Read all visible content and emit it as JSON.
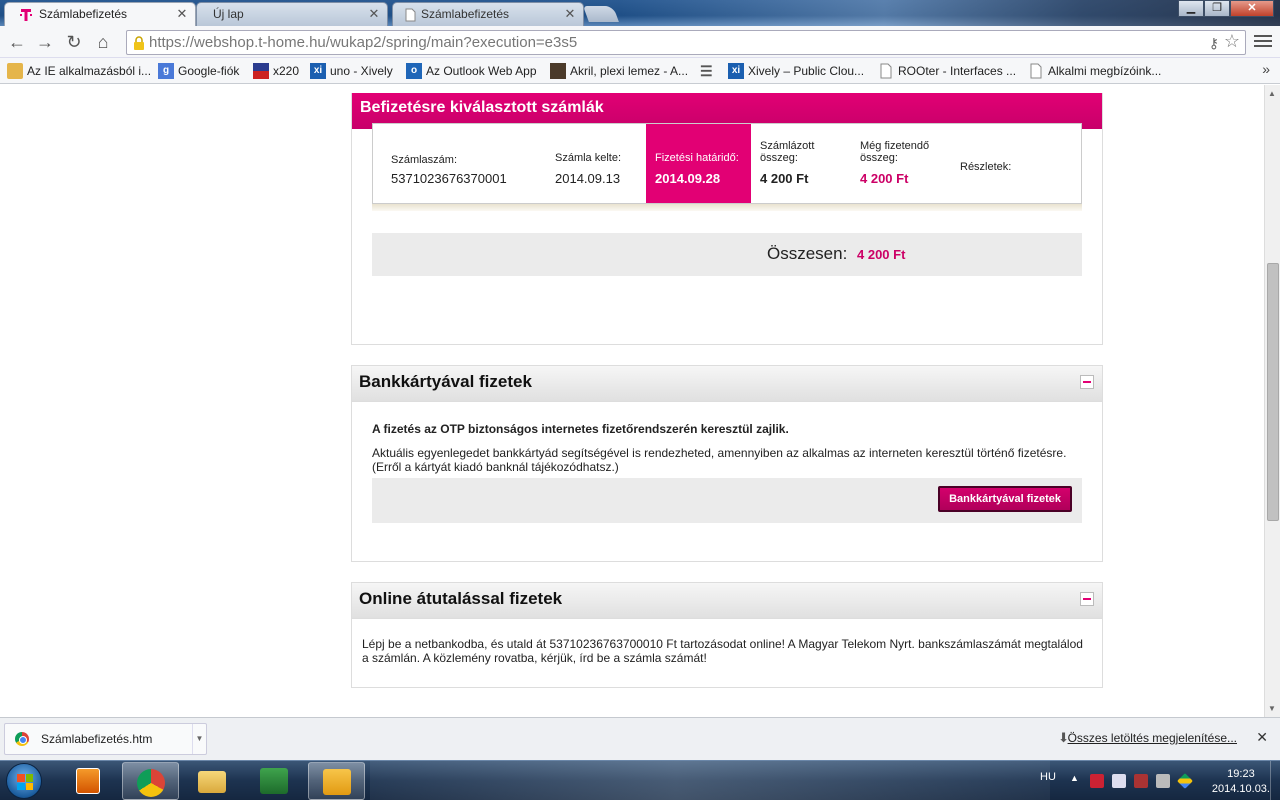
{
  "browser": {
    "tabs": [
      {
        "label": "Számlabefizetés",
        "active": true
      },
      {
        "label": "Új lap",
        "active": false
      },
      {
        "label": "Számlabefizetés",
        "active": false
      }
    ],
    "url_host": "https://webshop.t-home.hu",
    "url_path": "/wukap2/spring/main?execution=e3s5",
    "bookmarks": [
      "Az IE alkalmazásból i...",
      "Google-fiók",
      "x220",
      "uno - Xively",
      "Az Outlook Web App",
      "Akril, plexi lemez - A...",
      "Xively – Public Clou...",
      "ROOter - Interfaces ...",
      "Alkalmi megbízóink..."
    ],
    "bookmarks_more": "»"
  },
  "invoices": {
    "header": "Befizetésre kiválasztott számlák",
    "columns": {
      "number_label": "Számlaszám:",
      "number_value": "5371023676370001",
      "date_label": "Számla kelte:",
      "date_value": "2014.09.13",
      "due_label": "Fizetési határidő:",
      "due_value": "2014.09.28",
      "billed_label": "Számlázott összeg:",
      "billed_value": "4 200 Ft",
      "remaining_label": "Még fizetendő összeg:",
      "remaining_value": "4 200 Ft",
      "details_label": "Részletek:"
    },
    "total_label": "Összesen:",
    "total_value": "4 200 Ft"
  },
  "card_payment": {
    "header": "Bankkártyával fizetek",
    "intro": "A fizetés az OTP biztonságos internetes fizetőrendszerén keresztül zajlik.",
    "info": "Aktuális egyenlegedet bankkártyád segítségével is rendezheted, amennyiben az alkalmas az interneten keresztül történő fizetésre. (Erről a kártyát kiadó banknál tájékozódhatsz.)",
    "button": "Bankkártyával fizetek"
  },
  "transfer_payment": {
    "header": "Online átutalással fizetek",
    "text": "Lépj be a netbankodba, és utald át 53710236763700010 Ft tartozásodat online! A Magyar Telekom Nyrt. bankszámlaszámát megtalálod a számlán. A közlemény rovatba, kérjük, írd be a számla számát!"
  },
  "downloads": {
    "file": "Számlabefizetés.htm",
    "show_all": "Összes letöltés megjelenítése..."
  },
  "taskbar": {
    "lang": "HU",
    "time": "19:23",
    "date": "2014.10.03."
  },
  "colors": {
    "brand": "#e20074",
    "pink_text": "#cc0066"
  }
}
